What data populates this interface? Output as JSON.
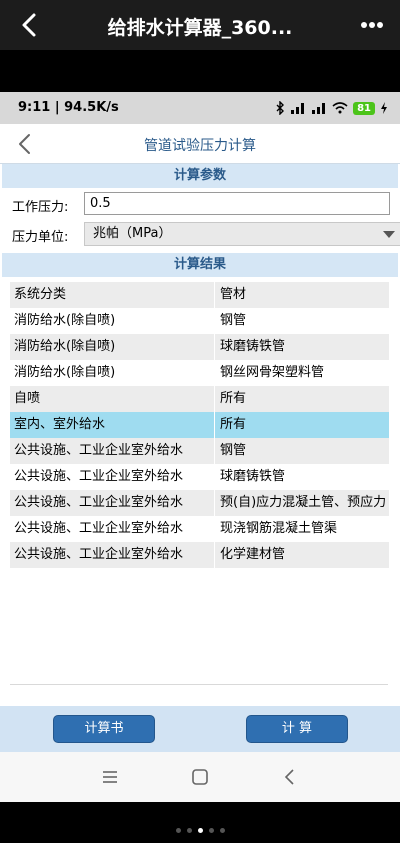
{
  "outer_bar": {
    "title": "给排水计算器_360..."
  },
  "status_bar": {
    "time_speed": "9:11 | 94.5K/s",
    "battery": "81"
  },
  "header": {
    "title": "管道试验压力计算"
  },
  "params": {
    "section_title": "计算参数",
    "pressure_label": "工作压力:",
    "pressure_value": "0.5",
    "unit_label": "压力单位:",
    "unit_value": "兆帕（MPa）"
  },
  "results": {
    "section_title": "计算结果",
    "columns": [
      "系统分类",
      "管材"
    ],
    "rows": [
      {
        "category": "消防给水(除自喷)",
        "material": "钢管"
      },
      {
        "category": "消防给水(除自喷)",
        "material": "球磨铸铁管"
      },
      {
        "category": "消防给水(除自喷)",
        "material": "钢丝网骨架塑料管"
      },
      {
        "category": "自喷",
        "material": "所有"
      },
      {
        "category": "室内、室外给水",
        "material": "所有"
      },
      {
        "category": "公共设施、工业企业室外给水",
        "material": "钢管"
      },
      {
        "category": "公共设施、工业企业室外给水",
        "material": "球磨铸铁管"
      },
      {
        "category": "公共设施、工业企业室外给水",
        "material": "预(自)应力混凝土管、预应力"
      },
      {
        "category": "公共设施、工业企业室外给水",
        "material": "现浇钢筋混凝土管渠"
      },
      {
        "category": "公共设施、工业企业室外给水",
        "material": "化学建材管"
      }
    ],
    "selected_row": 4
  },
  "buttons": {
    "report": "计算书",
    "calculate": "计 算"
  },
  "colors": {
    "accent": "#2f6fb1",
    "section_bg": "#d5e6f5",
    "selected_row": "#9fdcf0"
  }
}
